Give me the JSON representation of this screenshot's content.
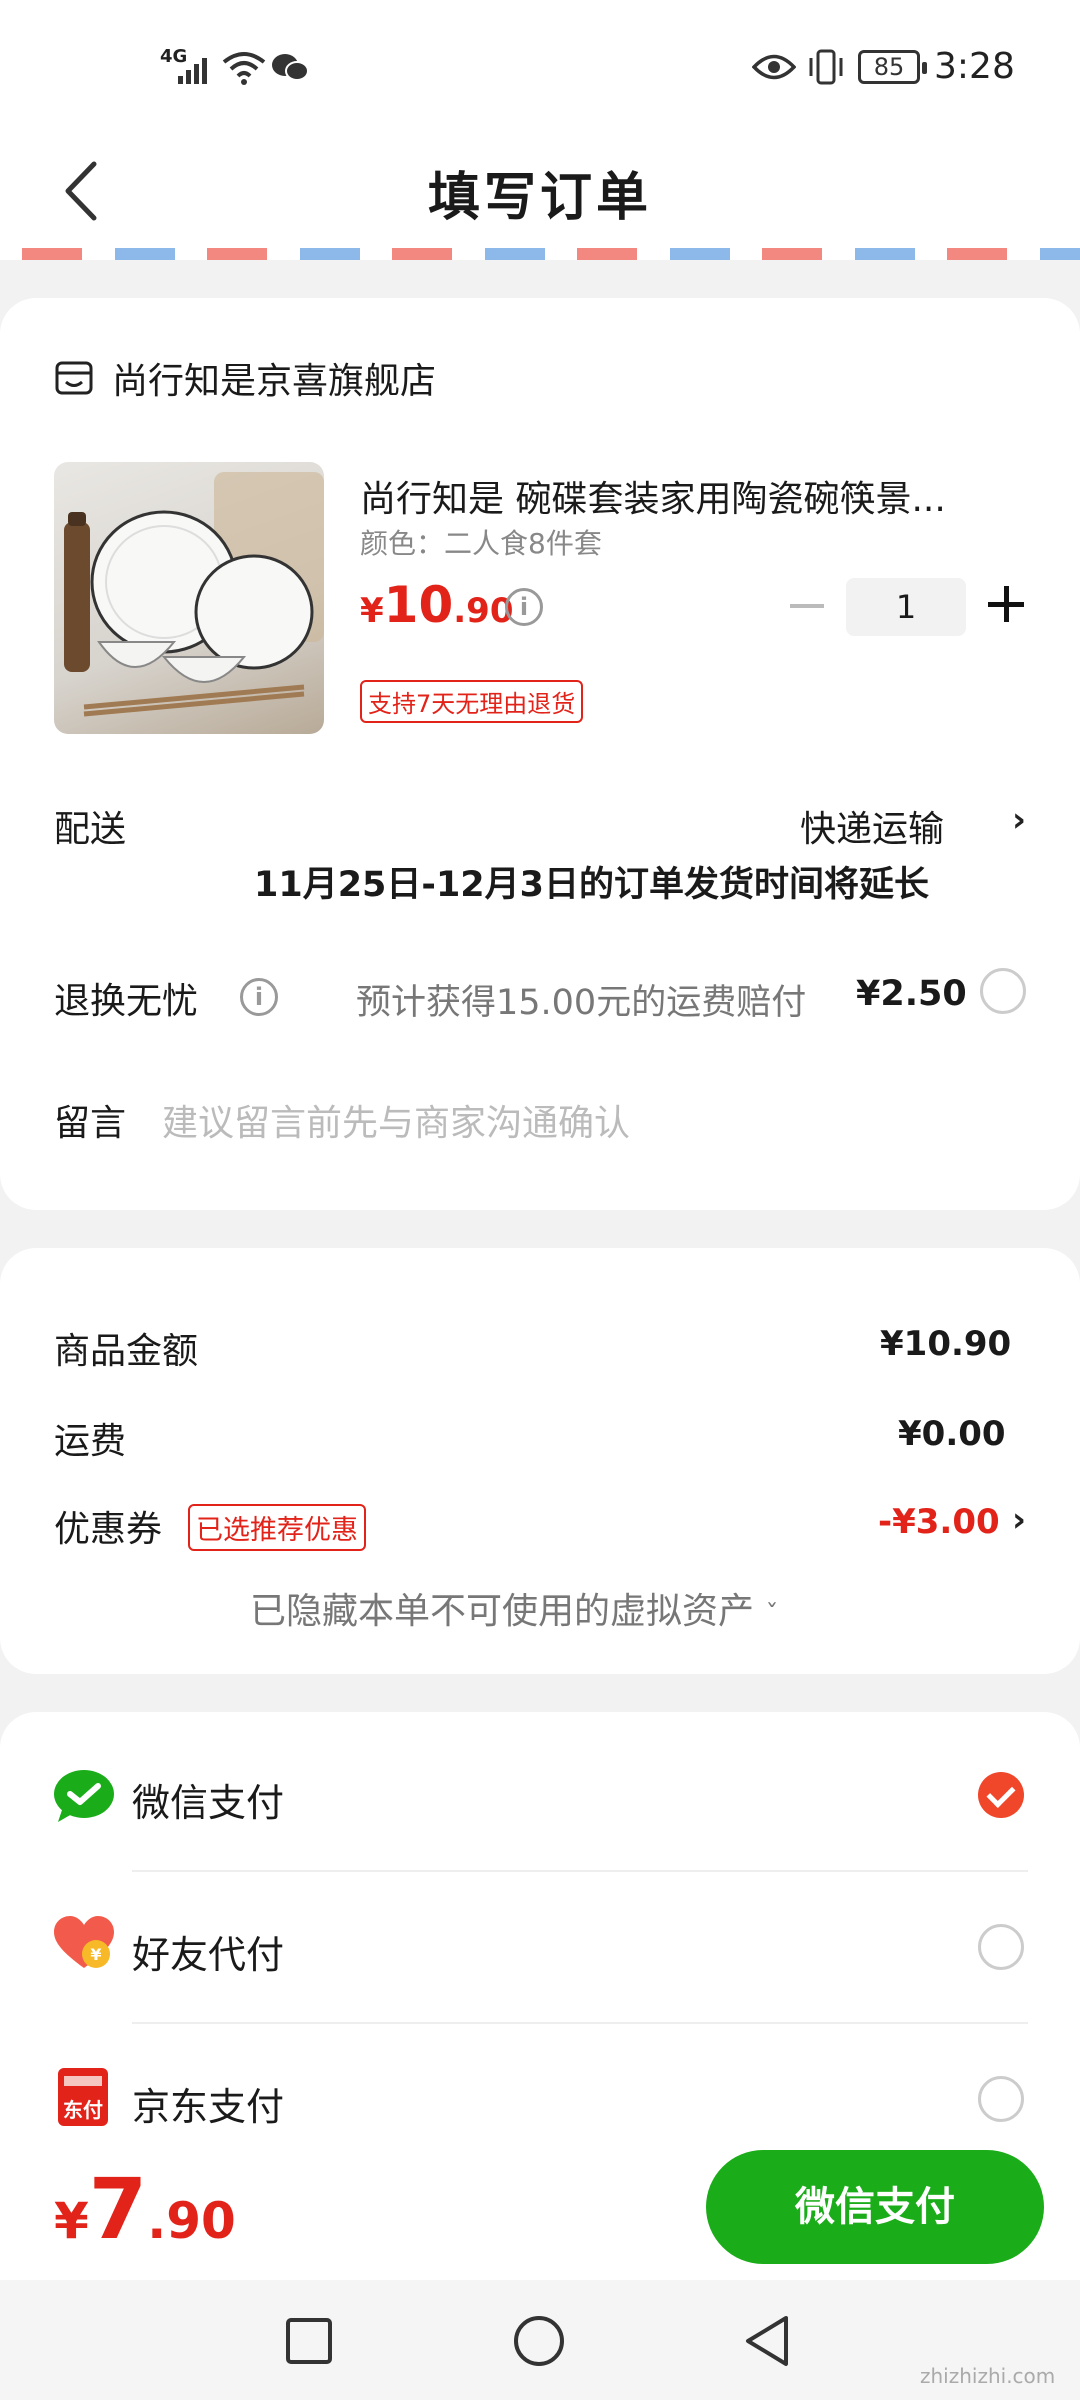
{
  "status_bar": {
    "network": "4G",
    "battery": "85",
    "time": "3:28"
  },
  "header": {
    "title": "填写订单"
  },
  "shop": {
    "name": "尚行知是京喜旗舰店"
  },
  "product": {
    "name": "尚行知是 碗碟套装家用陶瓷碗筷景...",
    "spec": "颜色：二人食8件套",
    "price_symbol": "¥",
    "price_int": "10",
    "price_dec": ".90",
    "quantity": "1",
    "tag": "支持7天无理由退货"
  },
  "delivery": {
    "label": "配送",
    "method": "快递运输",
    "notice": "11月25日-12月3日的订单发货时间将延长"
  },
  "return_insurance": {
    "label": "退换无忧",
    "desc": "预计获得15.00元的运费赔付",
    "price": "¥2.50"
  },
  "message": {
    "label": "留言",
    "placeholder": "建议留言前先与商家沟通确认"
  },
  "summary": {
    "goods_label": "商品金额",
    "goods_value": "¥10.90",
    "shipping_label": "运费",
    "shipping_value": "¥0.00",
    "coupon_label": "优惠券",
    "coupon_tag": "已选推荐优惠",
    "coupon_value": "-¥3.00",
    "hidden_assets": "已隐藏本单不可使用的虚拟资产"
  },
  "payment": {
    "options": [
      {
        "label": "微信支付",
        "selected": true
      },
      {
        "label": "好友代付",
        "selected": false
      },
      {
        "label": "京东支付",
        "selected": false
      }
    ],
    "jd_icon_text": "东付"
  },
  "bottom": {
    "total_symbol": "¥",
    "total_int": "7",
    "total_dec": ".90",
    "pay_button": "微信支付"
  },
  "watermark": "zhizhizhi.com",
  "colors": {
    "accent_red": "#e2231a",
    "wechat_green": "#1aad19",
    "check_orange": "#f0462a"
  }
}
